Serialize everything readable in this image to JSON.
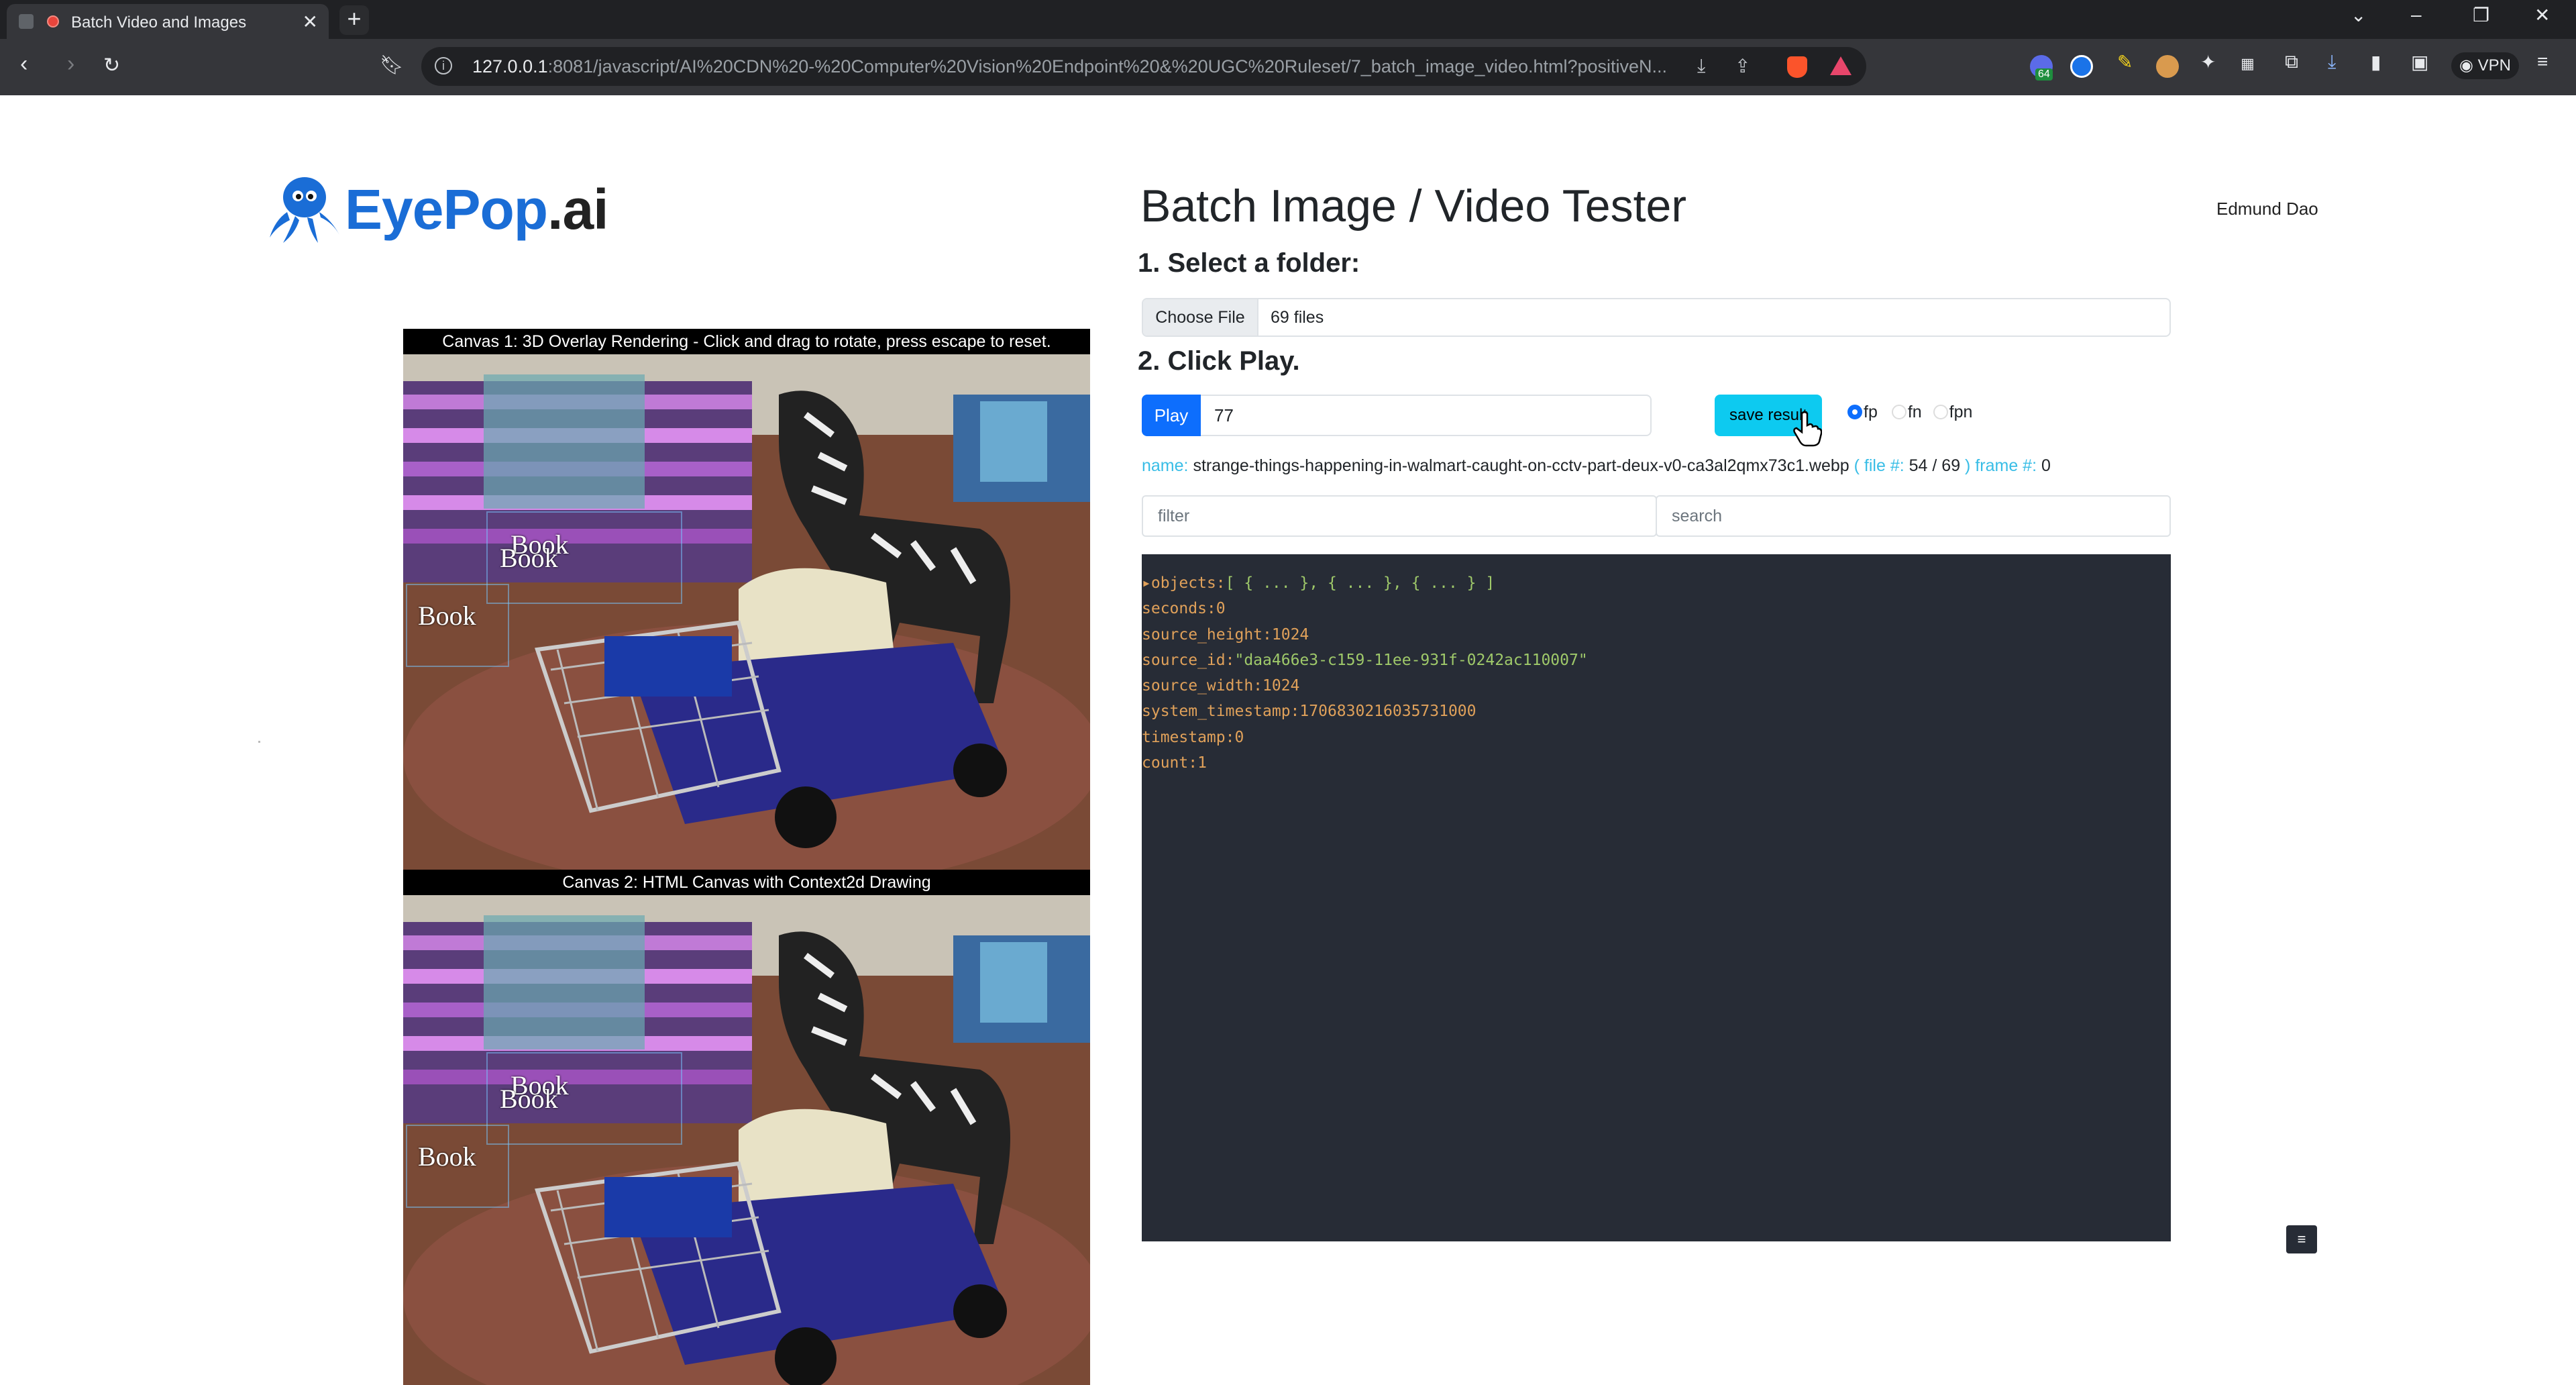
{
  "browser": {
    "tab_title": "Batch Video and Images",
    "url_main": "127.0.0.1",
    "url_rest": ":8081/javascript/AI%20CDN%20-%20Computer%20Vision%20Endpoint%20&%20UGC%20Ruleset/7_batch_image_video.html?positiveN...",
    "vpn_label": "VPN",
    "ext_badge": "64"
  },
  "page": {
    "logo_brand": "EyePop",
    "logo_tld": ".ai",
    "title": "Batch Image / Video Tester",
    "user_name": "Edmund Dao",
    "step1_label": "1. Select a folder:",
    "choose_file_label": "Choose File",
    "file_count": "69 files",
    "step2_label": "2. Click Play.",
    "play_label": "Play",
    "play_value": "77",
    "save_label": "save result",
    "radio_options": [
      "fp",
      "fn",
      "fpn"
    ],
    "radio_selected": "fp",
    "info": {
      "name_label": "name:",
      "name_value": "strange-things-happening-in-walmart-caught-on-cctv-part-deux-v0-ca3al2qmx73c1.webp",
      "file_label": "( file #:",
      "file_value": "54 / 69",
      "frame_label": ") frame #:",
      "frame_value": "0"
    },
    "filter_placeholder": "filter",
    "search_placeholder": "search",
    "json_view": {
      "objects_key": "objects:",
      "objects_value": "[ { ... }, { ... }, { ... } ]",
      "rows": [
        {
          "key": "seconds:",
          "value": "0",
          "type": "n"
        },
        {
          "key": "source_height:",
          "value": "1024",
          "type": "n"
        },
        {
          "key": "source_id:",
          "value": "\"daa466e3-c159-11ee-931f-0242ac110007\"",
          "type": "s"
        },
        {
          "key": "source_width:",
          "value": "1024",
          "type": "n"
        },
        {
          "key": "system_timestamp:",
          "value": "1706830216035731000",
          "type": "n"
        },
        {
          "key": "timestamp:",
          "value": "0",
          "type": "n"
        },
        {
          "key": "count:",
          "value": "1",
          "type": "n"
        }
      ]
    },
    "canvas1_caption": "Canvas 1: 3D Overlay Rendering - Click and drag to rotate, press escape to reset.",
    "canvas2_caption": "Canvas 2: HTML Canvas with Context2d Drawing",
    "detection_label": "Book"
  }
}
